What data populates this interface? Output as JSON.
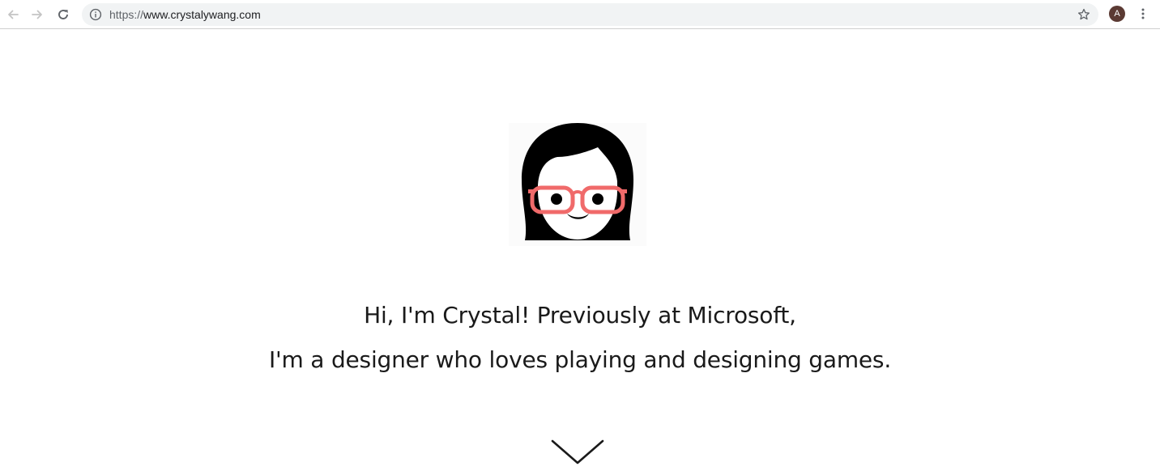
{
  "browser": {
    "url_scheme": "https://",
    "url_host": "www.crystalywang.com",
    "profile_initial": "A",
    "icons": {
      "back": "arrow-left-icon",
      "forward": "arrow-right-icon",
      "reload": "reload-icon",
      "site_info": "info-icon",
      "bookmark": "star-icon",
      "menu": "kebab-menu-icon"
    }
  },
  "hero": {
    "portrait_icon": "cartoon-girl-with-glasses-icon",
    "line1": "Hi, I'm Crystal! Previously at Microsoft,",
    "line2": "I'm a designer who loves playing and designing games.",
    "scroll_icon": "chevron-down-icon"
  },
  "colors": {
    "text": "#1a1a1a",
    "glasses": "#f06a6a",
    "hair": "#000000",
    "avatar": "#5b3a33",
    "omnibox": "#f1f3f4"
  }
}
